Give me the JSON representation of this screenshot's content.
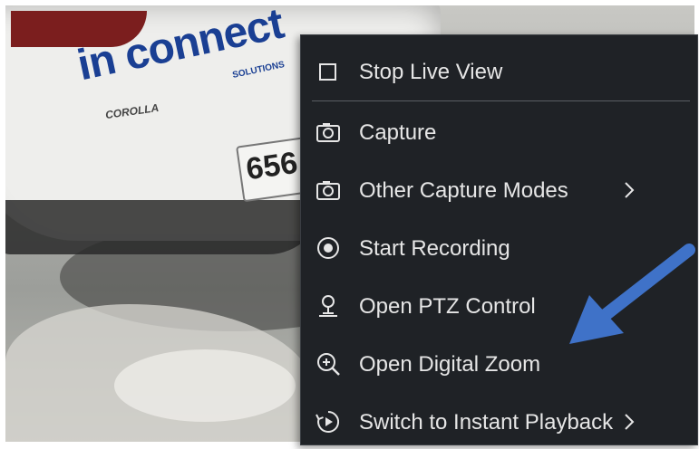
{
  "background": {
    "logo_text": "in connect",
    "logo_sub": "SOLUTIONS",
    "model_text": "COROLLA",
    "plate_text": "656"
  },
  "context_menu": {
    "items": [
      {
        "label": "Stop Live View",
        "icon": "checkbox-icon"
      },
      {
        "label": "Capture",
        "icon": "camera-icon"
      },
      {
        "label": "Other Capture Modes",
        "icon": "camera-icon",
        "submenu": true
      },
      {
        "label": "Start Recording",
        "icon": "record-icon"
      },
      {
        "label": "Open PTZ Control",
        "icon": "ptz-icon"
      },
      {
        "label": "Open Digital Zoom",
        "icon": "zoom-in-icon"
      },
      {
        "label": "Switch to Instant Playback",
        "icon": "playback-icon",
        "submenu": true
      }
    ]
  },
  "colors": {
    "menu_bg": "#1f2226",
    "menu_text": "#e6e6e6",
    "arrow_accent": "#3f72c8"
  }
}
